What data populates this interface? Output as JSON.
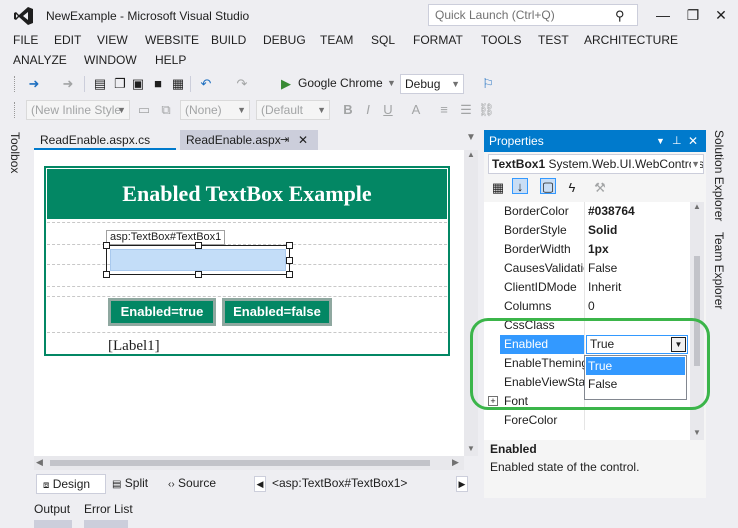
{
  "window": {
    "title": "NewExample - Microsoft Visual Studio",
    "quick_launch_placeholder": "Quick Launch (Ctrl+Q)",
    "minimize": "—",
    "restore": "❐",
    "close": "✕"
  },
  "menu": [
    "FILE",
    "EDIT",
    "VIEW",
    "WEBSITE",
    "BUILD",
    "DEBUG",
    "TEAM",
    "SQL",
    "FORMAT",
    "TOOLS",
    "TEST",
    "ARCHITECTURE",
    "ANALYZE",
    "WINDOW",
    "HELP"
  ],
  "toolbar": {
    "browser": "Google Chrome",
    "configuration": "Debug",
    "style_combo": "(New Inline Style",
    "class_combo": "(None)",
    "font_combo": "(Default"
  },
  "left_tabs": {
    "toolbox": "Toolbox"
  },
  "doc_tabs": [
    {
      "label": "ReadEnable.aspx.cs",
      "pin": ""
    },
    {
      "label": "ReadEnable.aspx",
      "pin": "⇥",
      "close": "✕"
    }
  ],
  "designer": {
    "header": "Enabled TextBox Example",
    "textbox_tag": "asp:TextBox#TextBox1",
    "button_true": "Enabled=true",
    "button_false": "Enabled=false",
    "label": "[Label1]"
  },
  "view_tabs": {
    "design": "Design",
    "split": "Split",
    "source": "Source",
    "breadcrumb": "<asp:TextBox#TextBox1>"
  },
  "properties": {
    "title": "Properties",
    "object_name": "TextBox1",
    "object_type": "System.Web.UI.WebControls",
    "rows": [
      {
        "name": "BorderColor",
        "value": "#038764",
        "bold": true
      },
      {
        "name": "BorderStyle",
        "value": "Solid",
        "bold": true
      },
      {
        "name": "BorderWidth",
        "value": "1px",
        "bold": true
      },
      {
        "name": "CausesValidation",
        "value": "False",
        "bold": false
      },
      {
        "name": "ClientIDMode",
        "value": "Inherit",
        "bold": false
      },
      {
        "name": "Columns",
        "value": "0",
        "bold": false
      },
      {
        "name": "CssClass",
        "value": "",
        "bold": false
      },
      {
        "name": "Enabled",
        "value": "True",
        "bold": false,
        "selected": true
      },
      {
        "name": "EnableTheming",
        "value": "",
        "bold": false
      },
      {
        "name": "EnableViewState",
        "value": "",
        "bold": false
      },
      {
        "name": "Font",
        "value": "",
        "bold": false,
        "expandable": true
      },
      {
        "name": "ForeColor",
        "value": "",
        "bold": false
      }
    ],
    "dropdown_options": [
      "True",
      "False"
    ],
    "dropdown_selected": "True",
    "description_title": "Enabled",
    "description": "Enabled state of the control."
  },
  "right_tabs": [
    "Solution Explorer",
    "Team Explorer"
  ],
  "bottom_tabs": [
    "Output",
    "Error List"
  ],
  "colors": {
    "accent": "#007ACC",
    "header_green": "#038764",
    "highlight": "#3BB54A"
  }
}
